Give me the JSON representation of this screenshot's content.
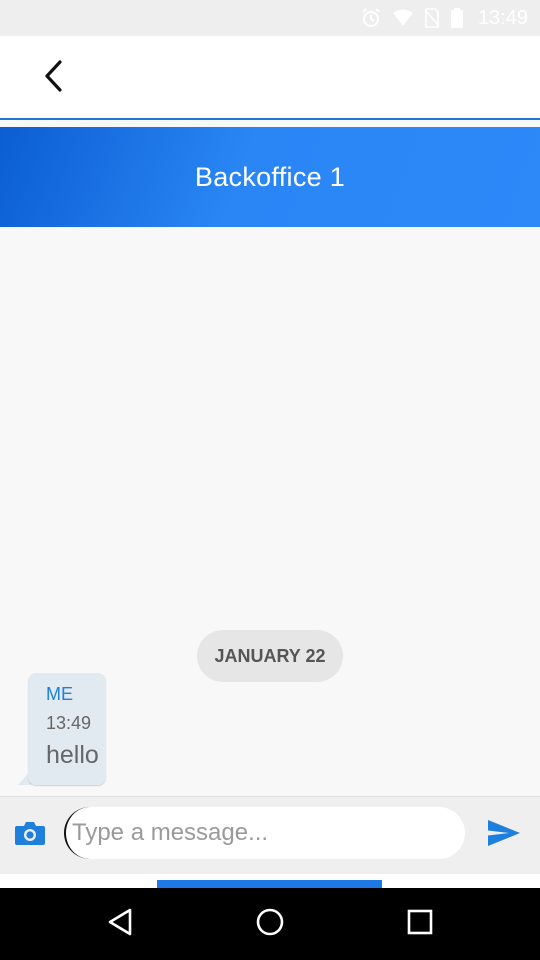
{
  "status_bar": {
    "time": "13:49",
    "icons": [
      "alarm-icon",
      "wifi-icon",
      "no-sim-icon",
      "battery-icon"
    ]
  },
  "app_bar": {
    "back_icon": "chevron-left-icon"
  },
  "header": {
    "title": "Backoffice 1"
  },
  "chat": {
    "date_separator": "JANUARY 22",
    "messages": [
      {
        "sender": "ME",
        "time": "13:49",
        "text": "hello"
      }
    ]
  },
  "composer": {
    "camera_icon": "camera-icon",
    "placeholder": "Type a message...",
    "value": "",
    "send_icon": "send-icon"
  },
  "nav_bar": {
    "buttons": [
      "back-triangle-icon",
      "home-circle-icon",
      "recents-square-icon"
    ]
  },
  "colors": {
    "accent": "#2d88f8",
    "accent_dark": "#0b5ed2",
    "sender_label": "#1e7fdc",
    "bubble": "#e2eaf1"
  }
}
